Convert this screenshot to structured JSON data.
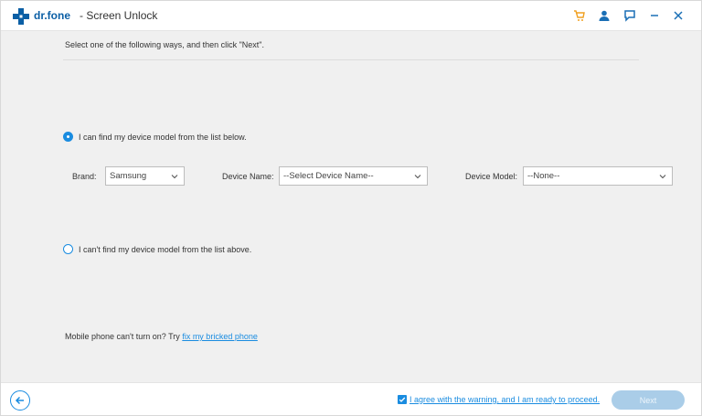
{
  "app": {
    "brand": "dr.fone",
    "title": "- Screen Unlock",
    "accent_color": "#1a8ce0",
    "icons": [
      "cart-icon",
      "user-icon",
      "feedback-icon",
      "minimize-icon",
      "close-icon"
    ]
  },
  "main": {
    "instruction": "Select one of the following ways, and then click \"Next\".",
    "option_list": {
      "label": "I can find my device model from the list below.",
      "selected": true
    },
    "brand_field": {
      "label": "Brand:",
      "value": "Samsung"
    },
    "device_name_field": {
      "label": "Device Name:",
      "value": "--Select Device Name--"
    },
    "device_model_field": {
      "label": "Device Model:",
      "value": "--None--"
    },
    "option_not_found": {
      "label": "I can't find my device model from the list above.",
      "selected": false
    },
    "bottom_note": {
      "prefix": "Mobile phone can't turn on? Try",
      "link": "fix my bricked phone"
    }
  },
  "footer": {
    "agree_text": "I agree with the warning, and I am ready to proceed.",
    "agree_checked": true,
    "next_label": "Next"
  }
}
